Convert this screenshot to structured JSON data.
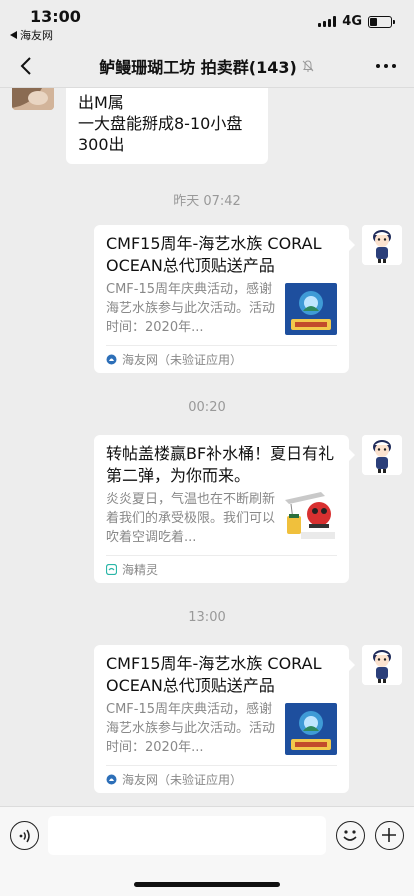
{
  "status_bar": {
    "time": "13:00",
    "back_app": "海友网",
    "network": "4G",
    "battery_level": 0.35
  },
  "nav": {
    "title": "鲈鳗珊瑚工坊 拍卖群(143)",
    "muted_icon": "mute-bell-icon"
  },
  "messages": {
    "first_text": [
      "出M属",
      "一大盘能掰成8-10小盘",
      "300出"
    ],
    "ts1": "昨天 07:42",
    "card1": {
      "title": "CMF15周年-海艺水族 CORAL OCEAN总代顶贴送产品",
      "desc": "CMF-15周年庆典活动，感谢海艺水族参与此次活动。活动时间：2020年...",
      "source": "海友网（未验证应用）"
    },
    "ts2": "00:20",
    "card2": {
      "title": "转帖盖楼赢BF补水桶！夏日有礼第二弹，为你而来。",
      "desc": "炎炎夏日，气温也在不断刷新着我们的承受极限。我们可以吹着空调吃着...",
      "source": "海精灵"
    },
    "ts3": "13:00",
    "card3": {
      "title": "CMF15周年-海艺水族 CORAL OCEAN总代顶贴送产品",
      "desc": "CMF-15周年庆典活动，感谢海艺水族参与此次活动。活动时间：2020年...",
      "source": "海友网（未验证应用）"
    }
  },
  "colors": {
    "background": "#ededed",
    "bubble": "#ffffff",
    "meta_text": "#888888"
  }
}
